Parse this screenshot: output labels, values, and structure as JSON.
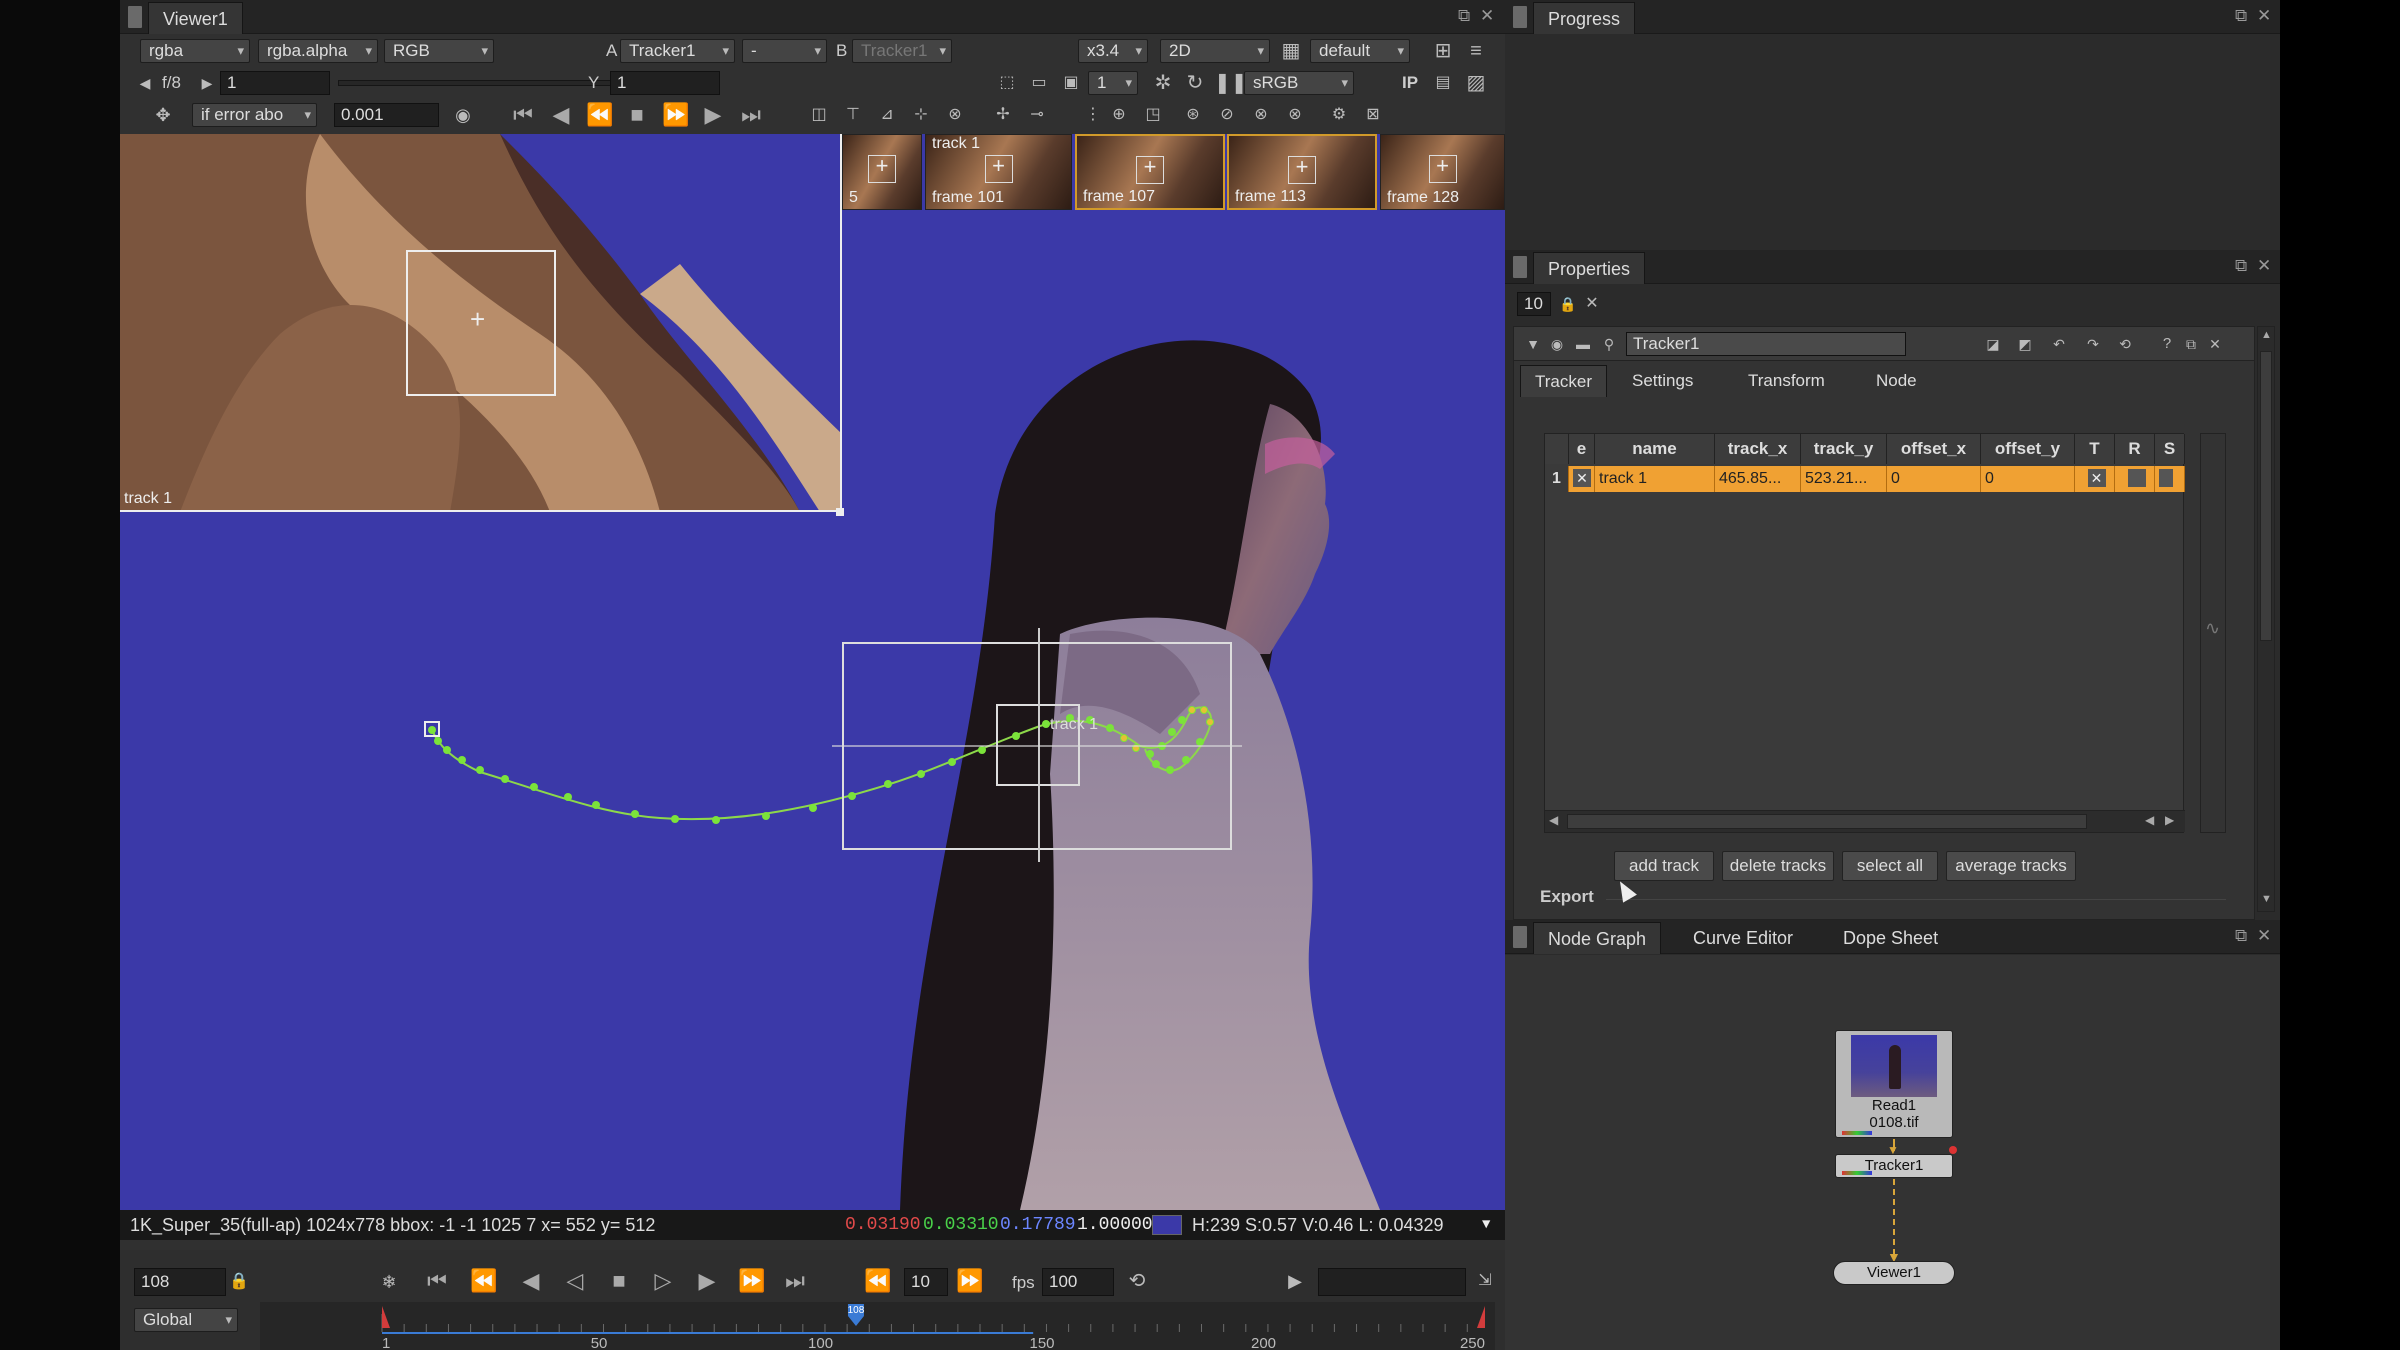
{
  "viewer": {
    "tab": "Viewer1",
    "channels": "rgba",
    "alpha": "rgba.alpha",
    "colorspace": "RGB",
    "a_label": "A",
    "a_input": "Tracker1",
    "op": "-",
    "b_label": "B",
    "b_input": "Tracker1",
    "zoom": "x3.4",
    "view_mode": "2D",
    "lut_preset": "default",
    "fstop": "f/8",
    "gain": "1",
    "gamma_label": "Y",
    "gamma": "1",
    "proxy": "1",
    "display_lut": "sRGB",
    "ip_label": "IP",
    "error_mode": "if error abo",
    "error_value": "0.001",
    "thumbnails": [
      {
        "label": "5",
        "selected": false
      },
      {
        "label": "frame 101",
        "title": "track 1",
        "selected": false
      },
      {
        "label": "frame 107",
        "selected": true
      },
      {
        "label": "frame 113",
        "selected": true
      },
      {
        "label": "frame 128",
        "selected": false
      }
    ],
    "zoom_window_label": "track 1",
    "track_label": "track 1",
    "info_bar": {
      "format": "1K_Super_35(full-ap) 1024x778 bbox: -1 -1 1025 7  x= 552 y= 512",
      "r": "0.03190",
      "g": "0.03310",
      "b": "0.17789",
      "a": "1.00000",
      "hsvl": "H:239 S:0.57 V:0.46  L: 0.04329"
    },
    "current_frame": "108",
    "skip_frames": "10",
    "fps_label": "fps",
    "fps": "100",
    "timeline_mode": "Global",
    "timeline_ticks": [
      "1",
      "50",
      "100",
      "150",
      "200",
      "250"
    ],
    "timeline_current": "108",
    "timeline_colors": {
      "playhead": "#3a7bd5",
      "in_point": "#d23c3c"
    }
  },
  "progress": {
    "tab": "Progress"
  },
  "properties": {
    "tab": "Properties",
    "max_panels": "10",
    "node_name": "Tracker1",
    "tabs": [
      "Tracker",
      "Settings",
      "Transform",
      "Node"
    ],
    "active_tab": "Tracker",
    "table": {
      "columns": [
        "e",
        "name",
        "track_x",
        "track_y",
        "offset_x",
        "offset_y",
        "T",
        "R",
        "S"
      ],
      "rows": [
        {
          "index": "1",
          "name": "track 1",
          "track_x": "465.85...",
          "track_y": "523.21...",
          "offset_x": "0",
          "offset_y": "0"
        }
      ]
    },
    "buttons": {
      "add": "add track",
      "delete": "delete tracks",
      "select_all": "select all",
      "average": "average tracks"
    },
    "export_label": "Export"
  },
  "nodegraph": {
    "tabs": [
      "Node Graph",
      "Curve Editor",
      "Dope Sheet"
    ],
    "active_tab": "Node Graph",
    "nodes": {
      "read": {
        "name": "Read1",
        "file": "0108.tif"
      },
      "tracker": {
        "name": "Tracker1"
      },
      "viewer": {
        "name": "Viewer1"
      }
    }
  },
  "colors": {
    "track_path": "#7be33a",
    "row_highlight": "#f0a133",
    "selection": "#d19a2a",
    "backdrop": "#3b39a8"
  }
}
